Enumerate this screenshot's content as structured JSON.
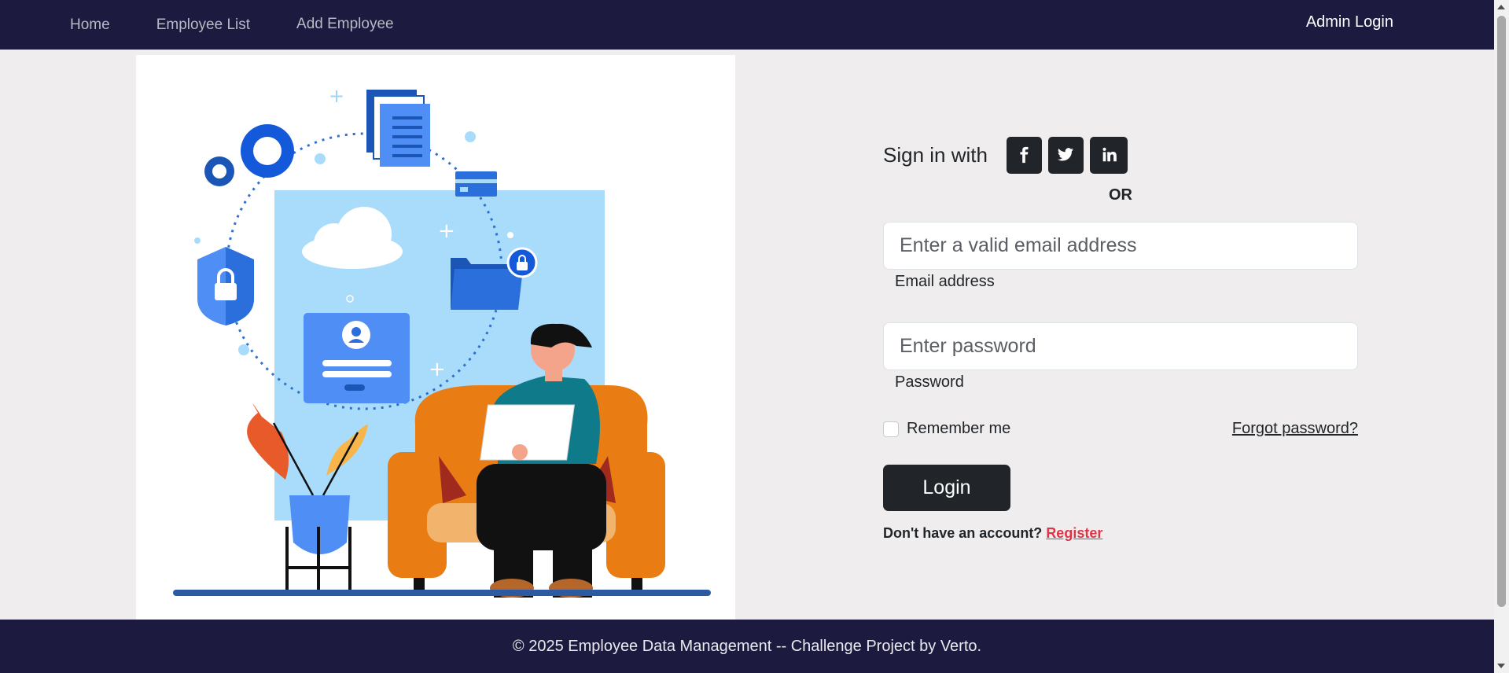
{
  "nav": {
    "links": [
      {
        "label": "Home"
      },
      {
        "label": "Employee List"
      },
      {
        "label": "Add Employee"
      }
    ],
    "admin_login": "Admin Login"
  },
  "form": {
    "social_label": "Sign in with",
    "social_icons": [
      "facebook-icon",
      "twitter-icon",
      "linkedin-icon"
    ],
    "or_text": "OR",
    "email": {
      "placeholder": "Enter a valid email address",
      "value": "",
      "label": "Email address"
    },
    "password": {
      "placeholder": "Enter password",
      "value": "",
      "label": "Password"
    },
    "remember_label": "Remember me",
    "remember_checked": false,
    "forgot_label": "Forgot password?",
    "login_label": "Login",
    "no_account_text": "Don't have an account?",
    "register_label": "Register"
  },
  "footer": {
    "text": "© 2025 Employee Data Management -- Challenge Project by Verto."
  },
  "colors": {
    "nav_bg": "#1c1b3f",
    "page_bg": "#efedee",
    "button_dark": "#212529",
    "register_red": "#dc3545"
  }
}
